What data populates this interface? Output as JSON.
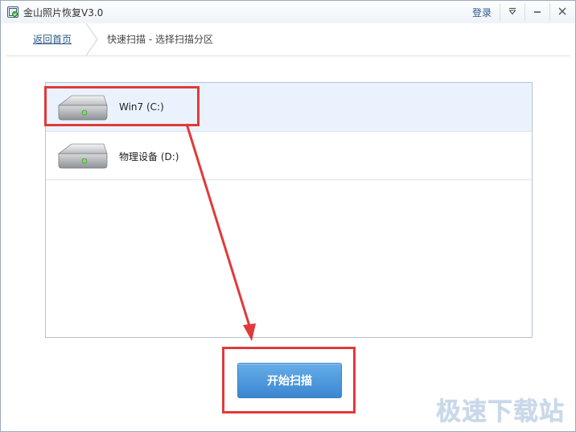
{
  "window": {
    "title": "金山照片恢复V3.0",
    "login_label": "登录"
  },
  "breadcrumb": {
    "back_label": "返回首页",
    "current_label": "快速扫描 - 选择扫描分区"
  },
  "drives": [
    {
      "label": "Win7 (C:)",
      "selected": true,
      "icon": "hard-drive-icon"
    },
    {
      "label": "物理设备 (D:)",
      "selected": false,
      "icon": "hard-drive-icon"
    }
  ],
  "actions": {
    "start_scan_label": "开始扫描"
  },
  "annotation": {
    "color": "#e03a3a"
  },
  "watermark": {
    "text": "极速下载站"
  },
  "colors": {
    "accent": "#3a86d0",
    "link": "#2b5a8a",
    "selected_row": "#eaf3fd"
  }
}
